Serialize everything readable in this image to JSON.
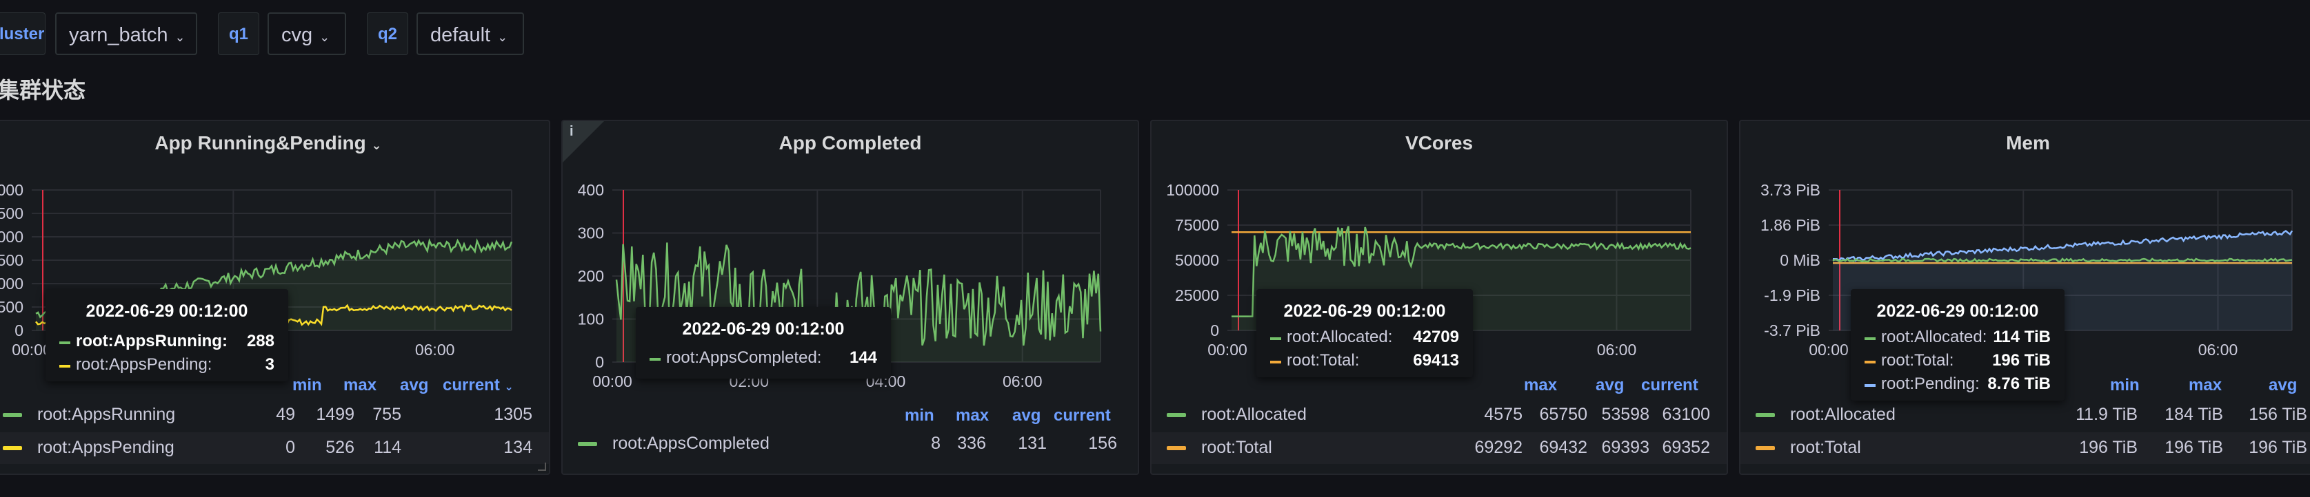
{
  "variables": [
    {
      "label": "luster",
      "value": "yarn_batch"
    },
    {
      "label": "q1",
      "value": "cvg"
    },
    {
      "label": "q2",
      "value": "default"
    }
  ],
  "row_title": "集群状态",
  "colors": {
    "green": "#73bf69",
    "yellow": "#fade2a",
    "orange": "#f2a93a",
    "cyan": "#8ab8ff",
    "light_blue": "#6e9fff",
    "red_marker": "#e02f44"
  },
  "panels": [
    {
      "title": "App Running&Pending",
      "yticks": [
        "000",
        "500",
        "000",
        "500",
        "000",
        "500",
        "0"
      ],
      "xticks": [
        "00:00",
        "06:00"
      ],
      "legend_headers": [
        "min",
        "max",
        "avg",
        "current"
      ],
      "legend": [
        {
          "name": "root:AppsRunning",
          "min": "49",
          "max": "1499",
          "avg": "755",
          "current": "1305"
        },
        {
          "name": "root:AppsPending",
          "min": "0",
          "max": "526",
          "avg": "114",
          "current": "134"
        }
      ],
      "tooltip": {
        "time": "2022-06-29 00:12:00",
        "rows": [
          {
            "name": "root:AppsRunning:",
            "value": "288"
          },
          {
            "name": "root:AppsPending:",
            "value": "3"
          }
        ]
      }
    },
    {
      "title": "App Completed",
      "info_icon": "i",
      "yticks": [
        "400",
        "300",
        "200",
        "100",
        "0"
      ],
      "xticks": [
        "00:00",
        "02:00",
        "04:00",
        "06:00"
      ],
      "legend_headers": [
        "min",
        "max",
        "avg",
        "current"
      ],
      "legend": [
        {
          "name": "root:AppsCompleted",
          "min": "8",
          "max": "336",
          "avg": "131",
          "current": "156"
        }
      ],
      "tooltip": {
        "time": "2022-06-29 00:12:00",
        "rows": [
          {
            "name": "root:AppsCompleted:",
            "value": "144"
          }
        ]
      }
    },
    {
      "title": "VCores",
      "yticks": [
        "100000",
        "75000",
        "50000",
        "25000",
        "0"
      ],
      "xticks": [
        "00:00",
        "06:00"
      ],
      "legend_headers": [
        "max",
        "avg",
        "current"
      ],
      "legend": [
        {
          "name": "root:Allocated",
          "min": "4575",
          "max": "65750",
          "avg": "53598",
          "current": "63100"
        },
        {
          "name": "root:Total",
          "min": "69292",
          "max": "69432",
          "avg": "69393",
          "current": "69352"
        }
      ],
      "tooltip": {
        "time": "2022-06-29 00:12:00",
        "rows": [
          {
            "name": "root:Allocated:",
            "value": "42709"
          },
          {
            "name": "root:Total:",
            "value": "69413"
          }
        ]
      }
    },
    {
      "title": "Mem",
      "yticks": [
        "3.73 PiB",
        "1.86 PiB",
        "0 MiB",
        "-1.9 PiB",
        "-3.7 PiB"
      ],
      "xticks": [
        "00:00",
        "06:00"
      ],
      "legend_headers": [
        "min",
        "max",
        "avg"
      ],
      "legend": [
        {
          "name": "root:Allocated",
          "min": "11.9 TiB",
          "max": "184 TiB",
          "avg": "156 TiB"
        },
        {
          "name": "root:Total",
          "min": "196 TiB",
          "max": "196 TiB",
          "avg": "196 TiB"
        }
      ],
      "tooltip": {
        "time": "2022-06-29 00:12:00",
        "rows": [
          {
            "name": "root:Allocated:",
            "value": "114 TiB"
          },
          {
            "name": "root:Total:",
            "value": "196 TiB"
          },
          {
            "name": "root:Pending:",
            "value": "8.76 TiB"
          }
        ]
      }
    }
  ]
}
